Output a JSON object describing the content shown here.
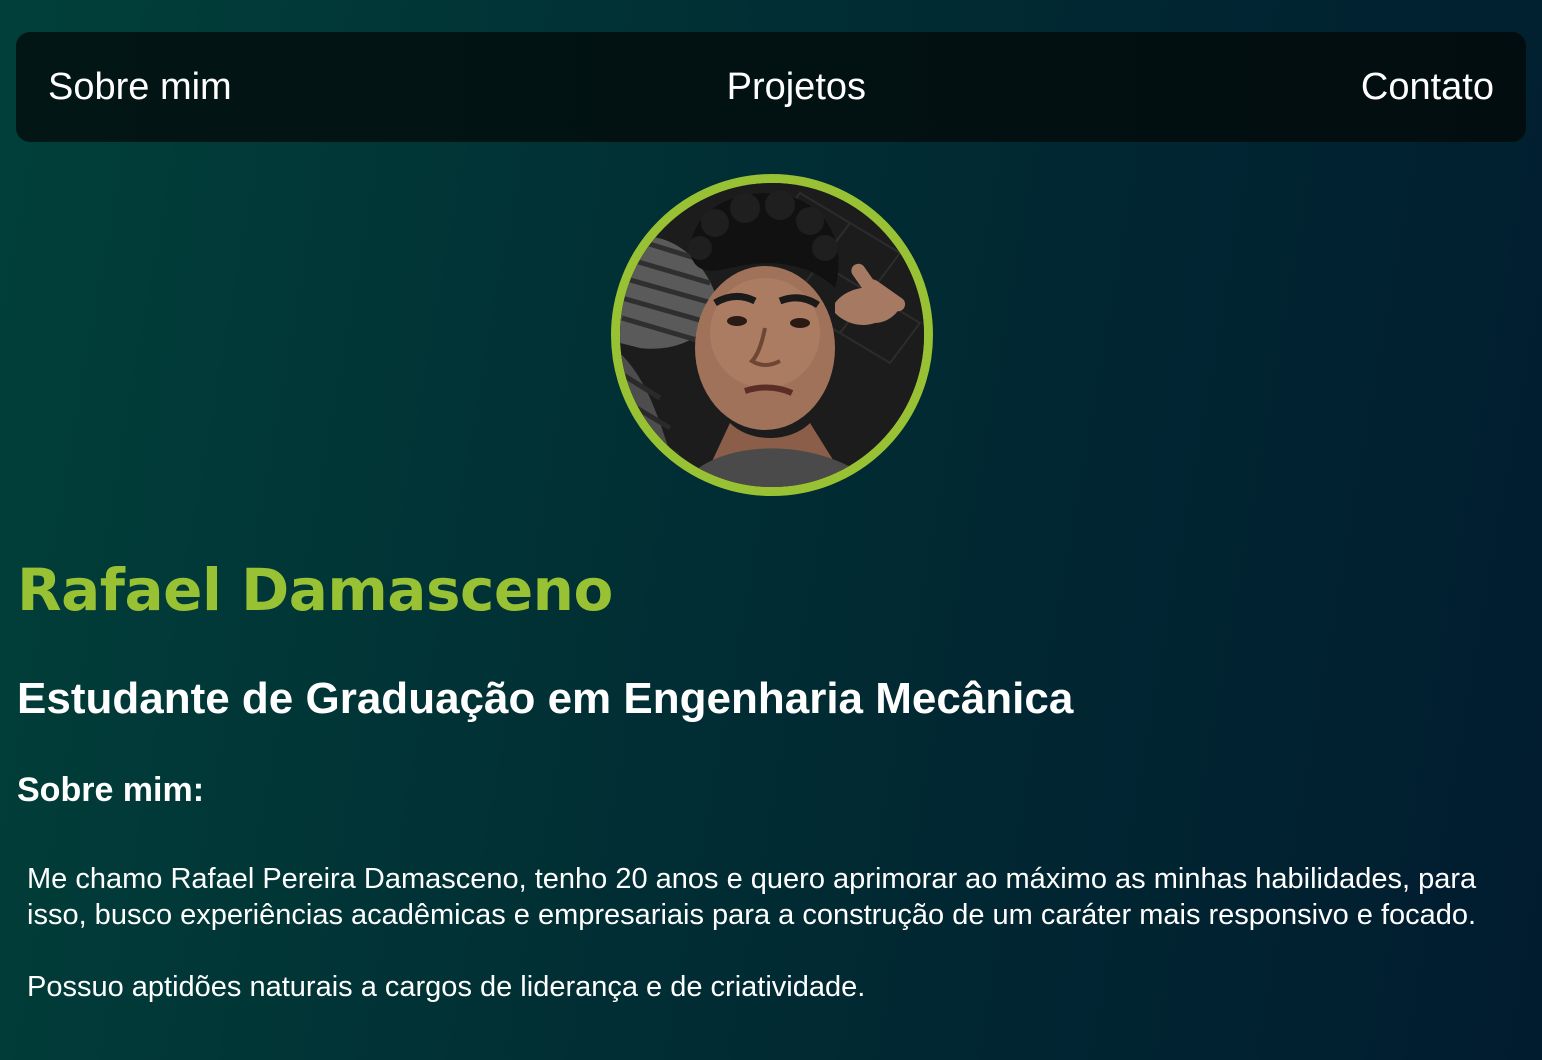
{
  "nav": {
    "items": [
      {
        "label": "Sobre mim"
      },
      {
        "label": "Projetos"
      },
      {
        "label": "Contato"
      }
    ]
  },
  "profile": {
    "name": "Rafael Damasceno",
    "subtitle": "Estudante de Graduação em Engenharia Mecânica",
    "avatar_icon": "profile-photo",
    "accent_color": "#98c233"
  },
  "about": {
    "title": "Sobre mim:",
    "paragraphs": [
      "Me chamo Rafael Pereira Damasceno, tenho 20 anos e quero aprimorar ao máximo as minhas habilidades, para isso, busco experiências acadêmicas e empresariais para a construção de um caráter mais responsivo e focado.",
      "Possuo aptidões naturais a cargos de liderança e de criatividade."
    ]
  }
}
